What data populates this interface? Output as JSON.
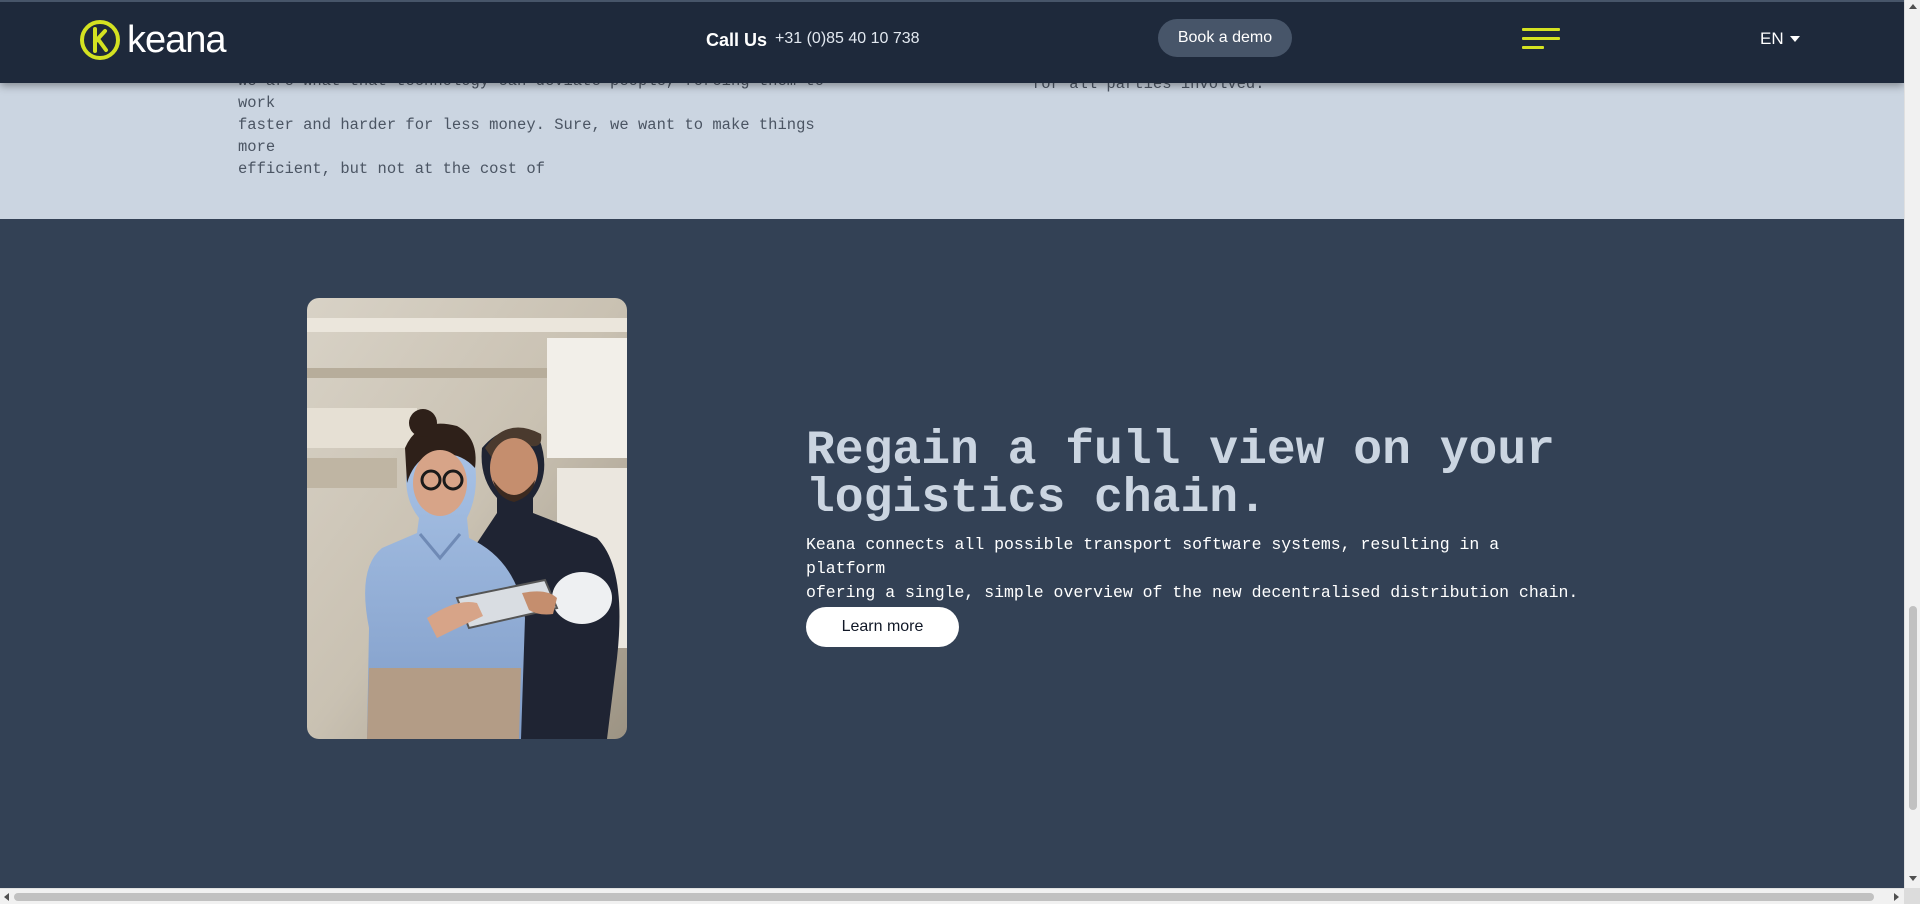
{
  "header": {
    "logo_text": "keana",
    "call_label": "Call Us",
    "phone": "+31 (0)85 40 10 738",
    "demo_button": "Book a demo",
    "menu_icon": "hamburger-menu-icon",
    "language": "EN",
    "accent_color": "#d4e221"
  },
  "intro": {
    "left_lines": [
      "We are what that technology can deviate people, forcing them to work",
      "faster and harder for less money. Sure, we want to make things more",
      "efficient, but not at the cost of"
    ],
    "right_text": "for all parties involved."
  },
  "feature": {
    "image_alt": "Woman with glasses using a tablet next to a smiling colleague in a warehouse",
    "title_line1": "Regain a full view on your",
    "title_line2": "logistics chain.",
    "description_line1": "Keana connects all possible transport software systems, resulting in a platform",
    "description_line2": "ofering a single, simple overview of the new decentralised distribution chain.",
    "button_label": "Learn more"
  },
  "colors": {
    "header_bg": "#1e293b",
    "light_section_bg": "#cbd5e1",
    "dark_section_bg": "#334155",
    "title_color": "#cbd5e1"
  }
}
